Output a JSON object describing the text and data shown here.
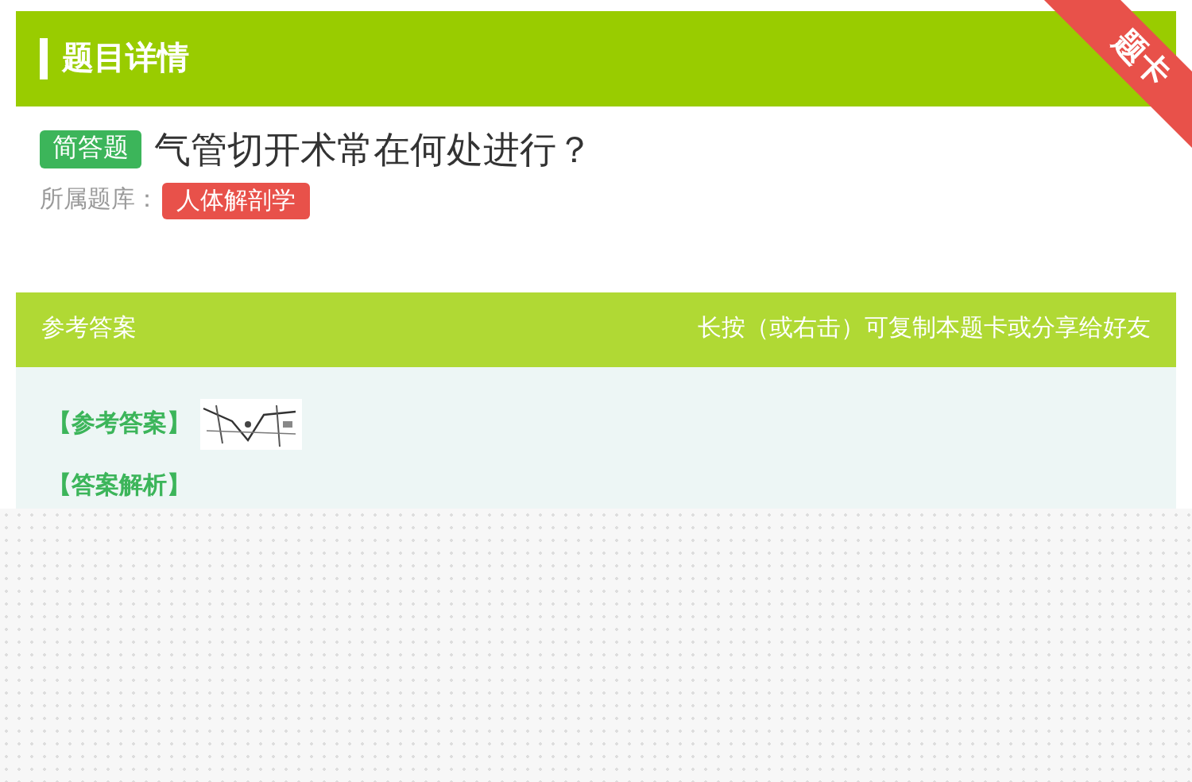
{
  "header": {
    "title": "题目详情",
    "ribbon": "题卡"
  },
  "question": {
    "type_tag": "简答题",
    "text": "气管切开术常在何处进行？",
    "bank_label": "所属题库：",
    "bank_tag": "人体解剖学"
  },
  "answer_bar": {
    "title": "参考答案",
    "hint": "长按（或右击）可复制本题卡或分享给好友"
  },
  "answer": {
    "answer_label": "【参考答案】",
    "analysis_label": "【答案解析】"
  }
}
